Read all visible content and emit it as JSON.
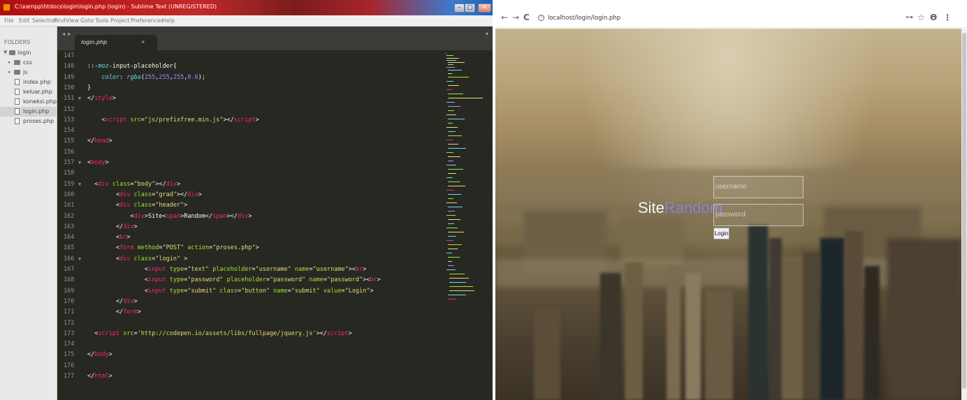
{
  "editor": {
    "window_title": "C:\\xampp\\htdocs\\login\\login.php (login) - Sublime Text (UNREGISTERED)",
    "window_buttons": {
      "minimize": "–",
      "maximize": "▢",
      "close": "✕"
    },
    "menu": [
      "File",
      "Edit",
      "Selection",
      "Find",
      "View",
      "Goto",
      "Tools",
      "Project",
      "Preferences",
      "Help"
    ],
    "sidebar": {
      "header": "FOLDERS",
      "root_folder": "login",
      "folders": [
        "css",
        "js"
      ],
      "files": [
        "index.php",
        "keluar.php",
        "koneksi.php",
        "login.php",
        "proses.php"
      ],
      "active_file": "login.php"
    },
    "tab": {
      "nav_arrows": "◂ ▸",
      "name": "login.php",
      "close": "×",
      "dropdown": "▾"
    },
    "code_lines": [
      {
        "n": "147",
        "fold": "",
        "tokens": []
      },
      {
        "n": "148",
        "fold": "",
        "tokens": [
          [
            "t-txt",
            "::-"
          ],
          [
            "t-kw",
            "moz"
          ],
          [
            "t-txt",
            "-input-placeholder{"
          ]
        ]
      },
      {
        "n": "149",
        "fold": "",
        "tokens": [
          [
            "t-txt",
            "    "
          ],
          [
            "t-kw",
            "color"
          ],
          [
            "t-txt",
            ": "
          ],
          [
            "t-kw",
            "rgba"
          ],
          [
            "t-txt",
            "("
          ],
          [
            "t-num",
            "255"
          ],
          [
            "t-txt",
            ","
          ],
          [
            "t-num",
            "255"
          ],
          [
            "t-txt",
            ","
          ],
          [
            "t-num",
            "255"
          ],
          [
            "t-txt",
            ","
          ],
          [
            "t-num",
            "0.6"
          ],
          [
            "t-txt",
            ");"
          ]
        ]
      },
      {
        "n": "150",
        "fold": "",
        "tokens": [
          [
            "t-txt",
            "}"
          ]
        ]
      },
      {
        "n": "151",
        "fold": "▼",
        "tokens": [
          [
            "t-txt",
            "</"
          ],
          [
            "t-tag",
            "style"
          ],
          [
            "t-txt",
            ">"
          ]
        ]
      },
      {
        "n": "152",
        "fold": "",
        "tokens": []
      },
      {
        "n": "153",
        "fold": "",
        "tokens": [
          [
            "t-txt",
            "    <"
          ],
          [
            "t-tag",
            "script"
          ],
          [
            "t-txt",
            " "
          ],
          [
            "t-attr",
            "src"
          ],
          [
            "t-txt",
            "="
          ],
          [
            "t-str",
            "\"js/prefixfree.min.js\""
          ],
          [
            "t-txt",
            "></"
          ],
          [
            "t-tag",
            "script"
          ],
          [
            "t-txt",
            ">"
          ]
        ]
      },
      {
        "n": "154",
        "fold": "",
        "tokens": []
      },
      {
        "n": "155",
        "fold": "",
        "tokens": [
          [
            "t-txt",
            "</"
          ],
          [
            "t-tag",
            "head"
          ],
          [
            "t-txt",
            ">"
          ]
        ]
      },
      {
        "n": "156",
        "fold": "",
        "tokens": []
      },
      {
        "n": "157",
        "fold": "▼",
        "tokens": [
          [
            "t-txt",
            "<"
          ],
          [
            "t-tag",
            "body"
          ],
          [
            "t-txt",
            ">"
          ]
        ]
      },
      {
        "n": "158",
        "fold": "",
        "tokens": []
      },
      {
        "n": "159",
        "fold": "▼",
        "tokens": [
          [
            "t-txt",
            "  <"
          ],
          [
            "t-tag",
            "div"
          ],
          [
            "t-txt",
            " "
          ],
          [
            "t-attr",
            "class"
          ],
          [
            "t-txt",
            "="
          ],
          [
            "t-str",
            "\"body\""
          ],
          [
            "t-txt",
            "></"
          ],
          [
            "t-tag",
            "div"
          ],
          [
            "t-txt",
            ">"
          ]
        ]
      },
      {
        "n": "160",
        "fold": "",
        "tokens": [
          [
            "t-txt",
            "        <"
          ],
          [
            "t-tag",
            "div"
          ],
          [
            "t-txt",
            " "
          ],
          [
            "t-attr",
            "class"
          ],
          [
            "t-txt",
            "="
          ],
          [
            "t-str",
            "\"grad\""
          ],
          [
            "t-txt",
            "></"
          ],
          [
            "t-tag",
            "div"
          ],
          [
            "t-txt",
            ">"
          ]
        ]
      },
      {
        "n": "161",
        "fold": "",
        "tokens": [
          [
            "t-txt",
            "        <"
          ],
          [
            "t-tag",
            "div"
          ],
          [
            "t-txt",
            " "
          ],
          [
            "t-attr",
            "class"
          ],
          [
            "t-txt",
            "="
          ],
          [
            "t-str",
            "\"header\""
          ],
          [
            "t-txt",
            ">"
          ]
        ]
      },
      {
        "n": "162",
        "fold": "",
        "tokens": [
          [
            "t-txt",
            "            <"
          ],
          [
            "t-tag",
            "div"
          ],
          [
            "t-txt",
            ">Site<"
          ],
          [
            "t-tag",
            "span"
          ],
          [
            "t-txt",
            ">Random</"
          ],
          [
            "t-tag",
            "span"
          ],
          [
            "t-txt",
            "></"
          ],
          [
            "t-tag",
            "div"
          ],
          [
            "t-txt",
            ">"
          ]
        ]
      },
      {
        "n": "163",
        "fold": "",
        "tokens": [
          [
            "t-txt",
            "        </"
          ],
          [
            "t-tag",
            "div"
          ],
          [
            "t-txt",
            ">"
          ]
        ]
      },
      {
        "n": "164",
        "fold": "",
        "tokens": [
          [
            "t-txt",
            "        <"
          ],
          [
            "t-tag",
            "br"
          ],
          [
            "t-txt",
            ">"
          ]
        ]
      },
      {
        "n": "165",
        "fold": "",
        "tokens": [
          [
            "t-txt",
            "        <"
          ],
          [
            "t-tag",
            "form"
          ],
          [
            "t-txt",
            " "
          ],
          [
            "t-attr",
            "method"
          ],
          [
            "t-txt",
            "="
          ],
          [
            "t-str",
            "\"POST\""
          ],
          [
            "t-txt",
            " "
          ],
          [
            "t-attr",
            "action"
          ],
          [
            "t-txt",
            "="
          ],
          [
            "t-str",
            "\"proses.php\""
          ],
          [
            "t-txt",
            ">"
          ]
        ]
      },
      {
        "n": "166",
        "fold": "▼",
        "tokens": [
          [
            "t-txt",
            "        <"
          ],
          [
            "t-tag",
            "div"
          ],
          [
            "t-txt",
            " "
          ],
          [
            "t-attr",
            "class"
          ],
          [
            "t-txt",
            "="
          ],
          [
            "t-str",
            "\"login\""
          ],
          [
            "t-txt",
            " >"
          ]
        ]
      },
      {
        "n": "167",
        "fold": "",
        "tokens": [
          [
            "t-txt",
            "                <"
          ],
          [
            "t-tag",
            "input"
          ],
          [
            "t-txt",
            " "
          ],
          [
            "t-attr",
            "type"
          ],
          [
            "t-txt",
            "="
          ],
          [
            "t-str",
            "\"text\""
          ],
          [
            "t-txt",
            " "
          ],
          [
            "t-attr",
            "placeholder"
          ],
          [
            "t-txt",
            "="
          ],
          [
            "t-str",
            "\"username\""
          ],
          [
            "t-txt",
            " "
          ],
          [
            "t-attr",
            "name"
          ],
          [
            "t-txt",
            "="
          ],
          [
            "t-str",
            "\"username\""
          ],
          [
            "t-txt",
            "><"
          ],
          [
            "t-tag",
            "br"
          ],
          [
            "t-txt",
            ">"
          ]
        ]
      },
      {
        "n": "168",
        "fold": "",
        "tokens": [
          [
            "t-txt",
            "                <"
          ],
          [
            "t-tag",
            "input"
          ],
          [
            "t-txt",
            " "
          ],
          [
            "t-attr",
            "type"
          ],
          [
            "t-txt",
            "="
          ],
          [
            "t-str",
            "\"password\""
          ],
          [
            "t-txt",
            " "
          ],
          [
            "t-attr",
            "placeholder"
          ],
          [
            "t-txt",
            "="
          ],
          [
            "t-str",
            "\"password\""
          ],
          [
            "t-txt",
            " "
          ],
          [
            "t-attr",
            "name"
          ],
          [
            "t-txt",
            "="
          ],
          [
            "t-str",
            "\"password\""
          ],
          [
            "t-txt",
            "><"
          ],
          [
            "t-tag",
            "br"
          ],
          [
            "t-txt",
            ">"
          ]
        ]
      },
      {
        "n": "169",
        "fold": "",
        "tokens": [
          [
            "t-txt",
            "                <"
          ],
          [
            "t-tag",
            "input"
          ],
          [
            "t-txt",
            " "
          ],
          [
            "t-attr",
            "type"
          ],
          [
            "t-txt",
            "="
          ],
          [
            "t-str",
            "\"submit\""
          ],
          [
            "t-txt",
            " "
          ],
          [
            "t-attr",
            "class"
          ],
          [
            "t-txt",
            "="
          ],
          [
            "t-str",
            "\"button\""
          ],
          [
            "t-txt",
            " "
          ],
          [
            "t-attr",
            "name"
          ],
          [
            "t-txt",
            "="
          ],
          [
            "t-str",
            "\"submit\""
          ],
          [
            "t-txt",
            " "
          ],
          [
            "t-attr",
            "value"
          ],
          [
            "t-txt",
            "="
          ],
          [
            "t-str",
            "\"Login\""
          ],
          [
            "t-txt",
            ">"
          ]
        ]
      },
      {
        "n": "170",
        "fold": "",
        "tokens": [
          [
            "t-txt",
            "        </"
          ],
          [
            "t-tag",
            "div"
          ],
          [
            "t-txt",
            ">"
          ]
        ]
      },
      {
        "n": "171",
        "fold": "",
        "tokens": [
          [
            "t-txt",
            "        </"
          ],
          [
            "t-tag",
            "form"
          ],
          [
            "t-txt",
            ">"
          ]
        ]
      },
      {
        "n": "172",
        "fold": "",
        "tokens": []
      },
      {
        "n": "173",
        "fold": "",
        "tokens": [
          [
            "t-txt",
            "  <"
          ],
          [
            "t-tag",
            "script"
          ],
          [
            "t-txt",
            " "
          ],
          [
            "t-attr",
            "src"
          ],
          [
            "t-txt",
            "="
          ],
          [
            "t-str",
            "'http://codepen.io/assets/libs/fullpage/jquery.js'"
          ],
          [
            "t-txt",
            "></"
          ],
          [
            "t-tag",
            "script"
          ],
          [
            "t-txt",
            ">"
          ]
        ]
      },
      {
        "n": "174",
        "fold": "",
        "tokens": []
      },
      {
        "n": "175",
        "fold": "",
        "tokens": [
          [
            "t-txt",
            "</"
          ],
          [
            "t-tag",
            "body"
          ],
          [
            "t-txt",
            ">"
          ]
        ]
      },
      {
        "n": "176",
        "fold": "",
        "tokens": []
      },
      {
        "n": "177",
        "fold": "",
        "tokens": [
          [
            "t-txt",
            "</"
          ],
          [
            "t-tag",
            "html"
          ],
          [
            "t-txt",
            ">"
          ]
        ]
      }
    ],
    "colors": {
      "background": "#272822",
      "tag": "#f92672",
      "attribute": "#a6e22e",
      "string": "#e6db74",
      "keyword": "#66d9ef",
      "number": "#ae81ff"
    }
  },
  "browser": {
    "nav": {
      "back": "←",
      "forward": "→",
      "reload": "C"
    },
    "url_icon": "i",
    "url": "localhost/login/login.php",
    "right_icons": {
      "key": "⊶",
      "star": "☆",
      "profile": "ϴ",
      "menu": "⋮"
    },
    "page": {
      "title_prefix": "Site",
      "title_accent": "Random",
      "username_placeholder": "username",
      "password_placeholder": "password",
      "login_button": "Login",
      "accent_color": "#8b80d8"
    }
  }
}
